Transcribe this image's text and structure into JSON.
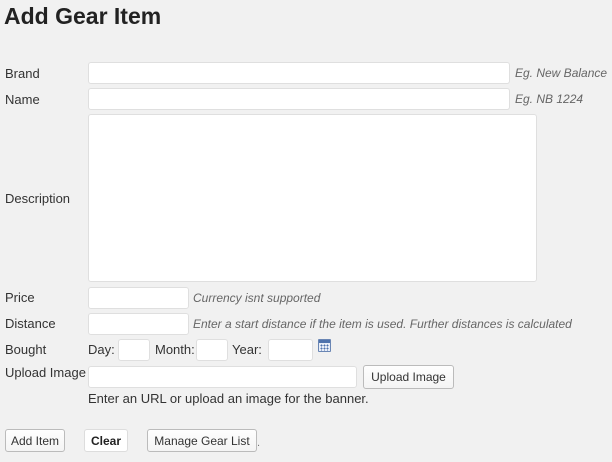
{
  "page": {
    "title": "Add Gear Item"
  },
  "form": {
    "brand": {
      "label": "Brand",
      "value": "",
      "hint": "Eg. New Balance"
    },
    "name": {
      "label": "Name",
      "value": "",
      "hint": "Eg. NB 1224"
    },
    "description": {
      "label": "Description",
      "value": ""
    },
    "price": {
      "label": "Price",
      "value": "",
      "hint": "Currency isnt supported"
    },
    "distance": {
      "label": "Distance",
      "value": "",
      "hint": "Enter a start distance if the item is used. Further distances is calculated"
    },
    "bought": {
      "label": "Bought",
      "day_label": "Day:",
      "day_value": "",
      "month_label": "Month:",
      "month_value": "",
      "year_label": "Year:",
      "year_value": "",
      "calendar_icon": "calendar-icon"
    },
    "upload_image": {
      "label": "Upload Image",
      "value": "",
      "button_label": "Upload Image",
      "help": "Enter an URL or upload an image for the banner."
    }
  },
  "actions": {
    "add_item": "Add Item",
    "clear": "Clear",
    "manage_gear_list": "Manage Gear List",
    "trailing_mark": "."
  }
}
